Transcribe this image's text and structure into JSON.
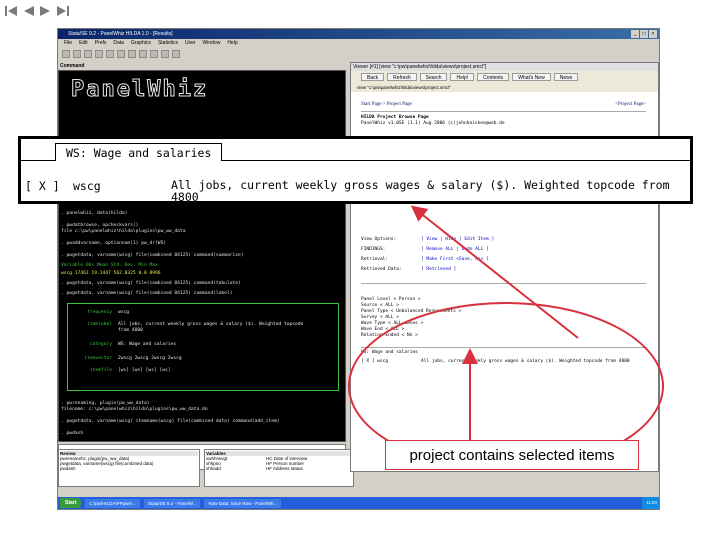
{
  "slide_nav": {
    "first_icon": "first-slide-icon",
    "prev_icon": "previous-slide-icon",
    "next_icon": "next-slide-icon",
    "last_icon": "last-slide-icon"
  },
  "window": {
    "title": "Stata/SE 9.2 - PanelWhiz HILDA 1.0 - [Results]",
    "menu": [
      "File",
      "Edit",
      "Prefs",
      "Data",
      "Graphics",
      "Statistics",
      "User",
      "Window",
      "Help"
    ]
  },
  "stata": {
    "command_label": "Command",
    "logo": "PanelWhiz",
    "lines": [
      ". panelwhiz, data(hilda)",
      ". pwdatbrowse, opcheckvars()",
      "file c:\\pw\\panelwhiz\\hilda\\plugins\\pw_ww_data",
      ". pwaddvarname, optionnam(1) pw_dr(WS)",
      ". pwgetdata, varname(wscg) file(combined 84125) command(summarize)",
      "   Variable        Obs       Mean    Std. Dev.       Min        Max",
      "       wscg      17461   19.1447     562.0325       0.0       8996",
      ". pwgetdata, varname(wscg) file(combined 84125) command(tabulate)",
      ". pwgetdata, varname(wscg) file(combined 84125) command(label)"
    ],
    "box_rows": [
      {
        "k": "frequency",
        "v": "wscg"
      },
      {
        "k": "itemlabel",
        "v": "All jobs, current weekly gross wages & salary ($). Weighted topcode"
      },
      {
        "k": "",
        "v": "from 4800"
      },
      {
        "k": "category",
        "v": "WS: Wage and salaries"
      },
      {
        "k": "itemvector",
        "v": "2wscg 2wscg 2wscg 2wscg"
      },
      {
        "k": "itemfile",
        "v": "[ws] [ws] [ws] [ws]"
      }
    ],
    "lines_after": [
      ". pwrenaming, plugin(pw_ww_data)",
      "filename: c:\\pw\\panelwhiz\\hilda\\plugins\\pw_ww_data.do",
      ". pwgetdata, varname(wscg) itemname(wscg) file(combined data) command(add_item)",
      ". pwdash"
    ],
    "review": {
      "label": "Review",
      "items": [
        "pwrenamehz, plugin(pw_ww_data)",
        "pwgetdata, varname(wscg) file(combined data)",
        "pwdash"
      ]
    },
    "variables": {
      "label": "Variables",
      "rows": [
        {
          "name": "xwhhrwvgt",
          "label": "HC Date of interview"
        },
        {
          "name": "xhhpno",
          "label": "HF Person number"
        },
        {
          "name": "xhhadd",
          "label": "HF Address status"
        }
      ]
    }
  },
  "browser": {
    "title": "Viewer [#1] [view \"c:\\pw\\panelwhiz\\hilda\\views\\project.smcl\"]",
    "buttons": [
      "Back",
      "Refresh",
      "Search",
      "Help!",
      "Contents",
      "What's New",
      "News"
    ],
    "address": "view \"c:\\pw\\panelwhiz\\hilda\\views\\project.smcl\"",
    "breadcrumb": "Start Page > Project Page",
    "breadcrumb_right": "<Project Page>",
    "header_lines": [
      "HILDA Project Browse Page",
      "PanelWhiz v1.0SE (1.1) Aug 2006 (c)johnhaisken@web.de"
    ],
    "rows": [
      {
        "k": "View Options:",
        "v": "[ View | Hide | Edit Item ]"
      },
      {
        "k": "FINDINGS:",
        "v": "[ Remove ALL | Undo ALL ]"
      },
      {
        "k": "Retrieval:",
        "v": "[ Make First <Save, As> ]"
      },
      {
        "k": "Retrieved Data:",
        "v": "[ Retrieved ]"
      }
    ],
    "detail_lines": [
      "Panel Level       < Person >",
      "Source            < ALL >",
      "Panel Type        < Unbalanced Respondents >",
      "Survey            < ALL >",
      "Wave Type         < ALL waves >",
      "Wave End          < ALL >",
      "Relation Ended    < No >"
    ]
  },
  "zoom": {
    "tab": "WS: Wage and salaries",
    "checkbox": "[ X ]",
    "varname": "wscg",
    "desc": "All jobs, current weekly gross wages & salary ($). Weighted topcode from 4800"
  },
  "callout": {
    "text": "project contains selected items",
    "color": "#d8303c"
  },
  "taskbar": {
    "start": "Start",
    "items": [
      "C:\\pw\\HILDA\\PPpwm...",
      "Stata/SE 9.2 - PanelW...",
      "Raw Data: Save Raw - PanelWh..."
    ],
    "tray": "11:04"
  }
}
